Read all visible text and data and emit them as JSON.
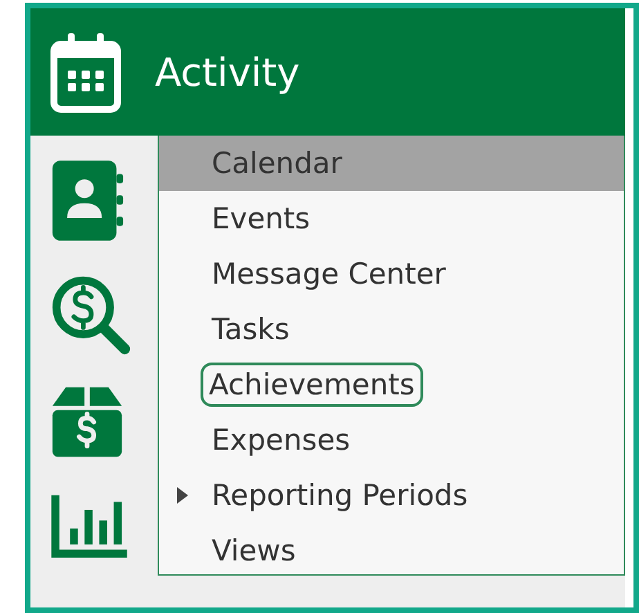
{
  "header": {
    "title": "Activity"
  },
  "menu": {
    "items": [
      {
        "label": "Calendar",
        "selected": true,
        "focused": false,
        "has_submenu": false
      },
      {
        "label": "Events",
        "selected": false,
        "focused": false,
        "has_submenu": false
      },
      {
        "label": "Message Center",
        "selected": false,
        "focused": false,
        "has_submenu": false
      },
      {
        "label": "Tasks",
        "selected": false,
        "focused": false,
        "has_submenu": false
      },
      {
        "label": "Achievements",
        "selected": false,
        "focused": true,
        "has_submenu": false
      },
      {
        "label": "Expenses",
        "selected": false,
        "focused": false,
        "has_submenu": false
      },
      {
        "label": "Reporting Periods",
        "selected": false,
        "focused": false,
        "has_submenu": true
      },
      {
        "label": "Views",
        "selected": false,
        "focused": false,
        "has_submenu": false
      }
    ]
  }
}
